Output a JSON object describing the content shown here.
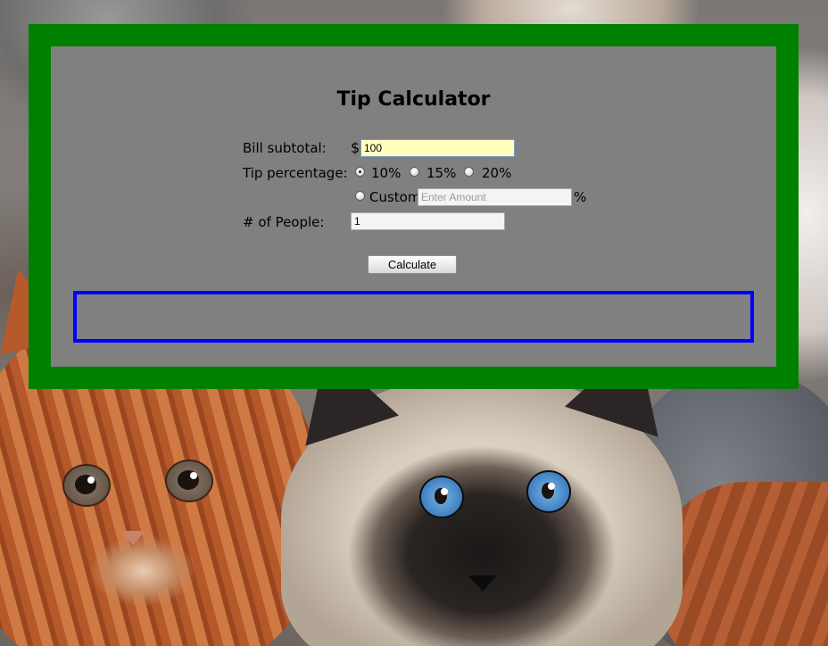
{
  "calculator": {
    "title": "Tip Calculator",
    "bill": {
      "label": "Bill subtotal:",
      "currency_symbol": "$",
      "value": "100"
    },
    "tip": {
      "label": "Tip percentage:",
      "options": [
        {
          "label": "10%",
          "selected": true
        },
        {
          "label": "15%",
          "selected": false
        },
        {
          "label": "20%",
          "selected": false
        }
      ],
      "custom": {
        "label": "Custom",
        "placeholder": "Enter Amount",
        "value": "",
        "unit": "%",
        "selected": false
      }
    },
    "people": {
      "label": "# of People:",
      "value": "1"
    },
    "calculate_label": "Calculate",
    "result_text": ""
  },
  "colors": {
    "outer_frame": "#008000",
    "panel": "#808080",
    "result_border": "#0000ff",
    "focused_input_bg": "#ffffc0"
  },
  "background": {
    "description_icons": [
      "ginger-kitten",
      "siamese-kitten",
      "grey-kitten"
    ]
  }
}
